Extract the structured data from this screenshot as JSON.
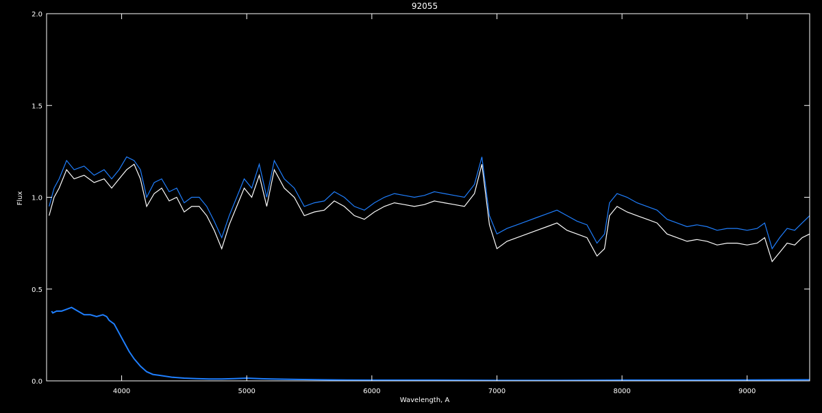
{
  "chart_data": {
    "type": "line",
    "title": "92055",
    "xlabel": "Wavelength, A",
    "ylabel": "Flux",
    "xlim": [
      3400,
      9500
    ],
    "ylim": [
      0,
      2
    ],
    "x_ticks": [
      4000,
      5000,
      6000,
      7000,
      8000,
      9000
    ],
    "y_ticks": [
      0.0,
      0.5,
      1.0,
      1.5,
      2.0
    ],
    "x_tick_labels": [
      "4000",
      "5000",
      "6000",
      "7000",
      "8000",
      "9000"
    ],
    "y_tick_labels": [
      "0.0",
      "0.5",
      "1.0",
      "1.5",
      "2.0"
    ],
    "grid": false,
    "background": "#000000",
    "axis_color": "#ffffff",
    "series": [
      {
        "color": "#ffffff",
        "x": [
          3420,
          3460,
          3500,
          3560,
          3620,
          3700,
          3780,
          3860,
          3920,
          3980,
          4040,
          4100,
          4150,
          4200,
          4260,
          4320,
          4380,
          4440,
          4500,
          4560,
          4620,
          4680,
          4740,
          4800,
          4860,
          4920,
          4980,
          5040,
          5100,
          5160,
          5220,
          5300,
          5380,
          5460,
          5540,
          5620,
          5700,
          5780,
          5860,
          5940,
          6020,
          6100,
          6180,
          6260,
          6340,
          6420,
          6500,
          6580,
          6660,
          6740,
          6820,
          6880,
          6940,
          7000,
          7080,
          7160,
          7240,
          7320,
          7400,
          7480,
          7560,
          7640,
          7720,
          7800,
          7860,
          7900,
          7960,
          8040,
          8120,
          8200,
          8280,
          8360,
          8440,
          8520,
          8600,
          8680,
          8760,
          8840,
          8920,
          9000,
          9080,
          9140,
          9200,
          9260,
          9320,
          9380,
          9440,
          9500
        ],
        "y": [
          0.9,
          1.0,
          1.05,
          1.15,
          1.1,
          1.12,
          1.08,
          1.1,
          1.05,
          1.1,
          1.15,
          1.18,
          1.1,
          0.95,
          1.02,
          1.05,
          0.98,
          1.0,
          0.92,
          0.95,
          0.95,
          0.9,
          0.82,
          0.72,
          0.85,
          0.95,
          1.05,
          1.0,
          1.12,
          0.95,
          1.15,
          1.05,
          1.0,
          0.9,
          0.92,
          0.93,
          0.98,
          0.95,
          0.9,
          0.88,
          0.92,
          0.95,
          0.97,
          0.96,
          0.95,
          0.96,
          0.98,
          0.97,
          0.96,
          0.95,
          1.02,
          1.18,
          0.85,
          0.72,
          0.76,
          0.78,
          0.8,
          0.82,
          0.84,
          0.86,
          0.82,
          0.8,
          0.78,
          0.68,
          0.72,
          0.9,
          0.95,
          0.92,
          0.9,
          0.88,
          0.86,
          0.8,
          0.78,
          0.76,
          0.77,
          0.76,
          0.74,
          0.75,
          0.75,
          0.74,
          0.75,
          0.78,
          0.65,
          0.7,
          0.75,
          0.74,
          0.78,
          0.8
        ]
      },
      {
        "color": "#1f7fff",
        "x": [
          3420,
          3460,
          3500,
          3560,
          3620,
          3700,
          3780,
          3860,
          3920,
          3980,
          4040,
          4100,
          4150,
          4200,
          4260,
          4320,
          4380,
          4440,
          4500,
          4560,
          4620,
          4680,
          4740,
          4800,
          4860,
          4920,
          4980,
          5040,
          5100,
          5160,
          5220,
          5300,
          5380,
          5460,
          5540,
          5620,
          5700,
          5780,
          5860,
          5940,
          6020,
          6100,
          6180,
          6260,
          6340,
          6420,
          6500,
          6580,
          6660,
          6740,
          6820,
          6880,
          6940,
          7000,
          7080,
          7160,
          7240,
          7320,
          7400,
          7480,
          7560,
          7640,
          7720,
          7800,
          7860,
          7900,
          7960,
          8040,
          8120,
          8200,
          8280,
          8360,
          8440,
          8520,
          8600,
          8680,
          8760,
          8840,
          8920,
          9000,
          9080,
          9140,
          9200,
          9260,
          9320,
          9380,
          9440,
          9500
        ],
        "y": [
          0.95,
          1.05,
          1.1,
          1.2,
          1.15,
          1.17,
          1.12,
          1.15,
          1.1,
          1.15,
          1.22,
          1.2,
          1.15,
          1.0,
          1.08,
          1.1,
          1.03,
          1.05,
          0.97,
          1.0,
          1.0,
          0.95,
          0.87,
          0.78,
          0.9,
          1.0,
          1.1,
          1.05,
          1.18,
          1.0,
          1.2,
          1.1,
          1.05,
          0.95,
          0.97,
          0.98,
          1.03,
          1.0,
          0.95,
          0.93,
          0.97,
          1.0,
          1.02,
          1.01,
          1.0,
          1.01,
          1.03,
          1.02,
          1.01,
          1.0,
          1.07,
          1.22,
          0.9,
          0.8,
          0.83,
          0.85,
          0.87,
          0.89,
          0.91,
          0.93,
          0.9,
          0.87,
          0.85,
          0.75,
          0.8,
          0.97,
          1.02,
          1.0,
          0.97,
          0.95,
          0.93,
          0.88,
          0.86,
          0.84,
          0.85,
          0.84,
          0.82,
          0.83,
          0.83,
          0.82,
          0.83,
          0.86,
          0.72,
          0.78,
          0.83,
          0.82,
          0.86,
          0.9
        ]
      },
      {
        "color": "#1f7fff",
        "x": [
          3440,
          3450,
          3480,
          3520,
          3560,
          3600,
          3650,
          3700,
          3750,
          3800,
          3850,
          3880,
          3900,
          3940,
          3980,
          4020,
          4060,
          4100,
          4150,
          4200,
          4250,
          4300,
          4400,
          4500,
          4600,
          4700,
          4800,
          4900,
          5000,
          5100,
          5200,
          5400,
          5600,
          5800,
          6000,
          6500,
          7000,
          7500,
          8000,
          8500,
          9000,
          9500
        ],
        "y": [
          0.38,
          0.37,
          0.38,
          0.38,
          0.39,
          0.4,
          0.38,
          0.36,
          0.36,
          0.35,
          0.36,
          0.35,
          0.33,
          0.31,
          0.26,
          0.21,
          0.16,
          0.12,
          0.08,
          0.05,
          0.035,
          0.03,
          0.02,
          0.015,
          0.012,
          0.01,
          0.01,
          0.012,
          0.015,
          0.012,
          0.01,
          0.008,
          0.006,
          0.005,
          0.004,
          0.004,
          0.003,
          0.003,
          0.004,
          0.004,
          0.005,
          0.006
        ]
      }
    ]
  }
}
